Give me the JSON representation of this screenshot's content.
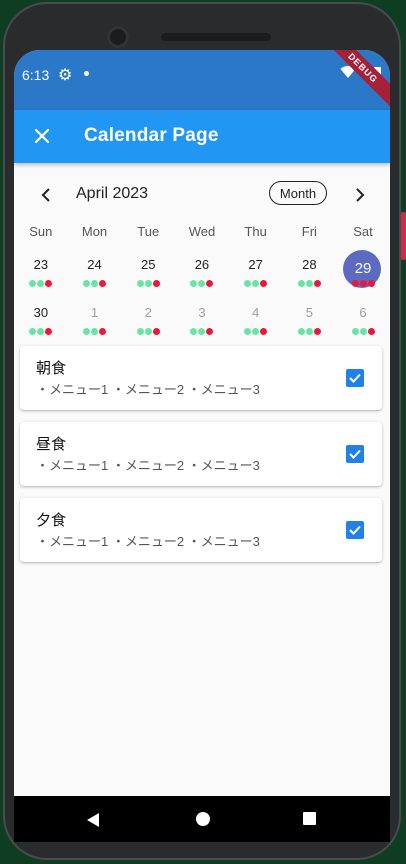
{
  "status": {
    "time": "6:13",
    "debug_label": "DEBUG"
  },
  "appbar": {
    "title": "Calendar Page"
  },
  "calendar": {
    "month_label": "April 2023",
    "format_button": "Month",
    "weekdays": [
      "Sun",
      "Mon",
      "Tue",
      "Wed",
      "Thu",
      "Fri",
      "Sat"
    ],
    "weeks": [
      [
        {
          "day": "23",
          "outside": false,
          "selected": false,
          "markers": [
            "green",
            "green",
            "red"
          ]
        },
        {
          "day": "24",
          "outside": false,
          "selected": false,
          "markers": [
            "green",
            "green",
            "red"
          ]
        },
        {
          "day": "25",
          "outside": false,
          "selected": false,
          "markers": [
            "green",
            "green",
            "red"
          ]
        },
        {
          "day": "26",
          "outside": false,
          "selected": false,
          "markers": [
            "green",
            "green",
            "red"
          ]
        },
        {
          "day": "27",
          "outside": false,
          "selected": false,
          "markers": [
            "green",
            "green",
            "red"
          ]
        },
        {
          "day": "28",
          "outside": false,
          "selected": false,
          "markers": [
            "green",
            "green",
            "red"
          ]
        },
        {
          "day": "29",
          "outside": false,
          "selected": true,
          "markers": [
            "red",
            "red",
            "red"
          ]
        }
      ],
      [
        {
          "day": "30",
          "outside": false,
          "selected": false,
          "markers": [
            "green",
            "green",
            "red"
          ]
        },
        {
          "day": "1",
          "outside": true,
          "selected": false,
          "markers": [
            "green",
            "green",
            "red"
          ]
        },
        {
          "day": "2",
          "outside": true,
          "selected": false,
          "markers": [
            "green",
            "green",
            "red"
          ]
        },
        {
          "day": "3",
          "outside": true,
          "selected": false,
          "markers": [
            "green",
            "green",
            "red"
          ]
        },
        {
          "day": "4",
          "outside": true,
          "selected": false,
          "markers": [
            "green",
            "green",
            "red"
          ]
        },
        {
          "day": "5",
          "outside": true,
          "selected": false,
          "markers": [
            "green",
            "green",
            "red"
          ]
        },
        {
          "day": "6",
          "outside": true,
          "selected": false,
          "markers": [
            "green",
            "green",
            "red"
          ]
        }
      ]
    ],
    "colors": {
      "green": "#69e4a6",
      "red": "#e8193c",
      "selected": "#5c6bc0"
    }
  },
  "meals": [
    {
      "title": "朝食",
      "items": "・メニュー1 ・メニュー2 ・メニュー3",
      "checked": true
    },
    {
      "title": "昼食",
      "items": "・メニュー1 ・メニュー2 ・メニュー3",
      "checked": true
    },
    {
      "title": "夕食",
      "items": "・メニュー1 ・メニュー2 ・メニュー3",
      "checked": true
    }
  ]
}
